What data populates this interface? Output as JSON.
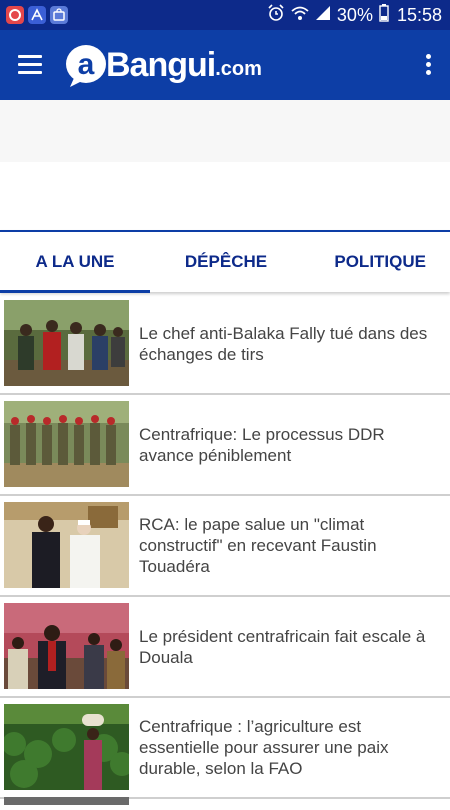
{
  "status_bar": {
    "battery_percent": "30%",
    "time": "15:58",
    "left_app_icons": [
      "app-notification-icon",
      "pdf-app-icon",
      "store-app-icon"
    ]
  },
  "app_bar": {
    "logo_text": "Bangui",
    "logo_domain": ".com",
    "logo_mark": "a",
    "menu_icon": "hamburger-menu-icon",
    "overflow_icon": "more-vertical-icon"
  },
  "tabs": [
    {
      "label": "A LA UNE",
      "selected": true
    },
    {
      "label": "DÉPÊCHE",
      "selected": false
    },
    {
      "label": "POLITIQUE",
      "selected": false
    }
  ],
  "articles": [
    {
      "title": "Le chef anti-Balaka Fally tué dans des échanges de tirs"
    },
    {
      "title": "Centrafrique: Le processus DDR avance péniblement"
    },
    {
      "title": "RCA: le pape salue un \"climat constructif\" en recevant Faustin Touadéra"
    },
    {
      "title": "Le président centrafricain fait escale à Douala"
    },
    {
      "title": "Centrafrique : l’agriculture est essentielle pour assurer une paix durable, selon la FAO"
    }
  ],
  "colors": {
    "status_bar": "#0d2a8a",
    "app_bar": "#0d3ea6",
    "tab_text": "#0d2a8a",
    "article_text": "#444444"
  }
}
